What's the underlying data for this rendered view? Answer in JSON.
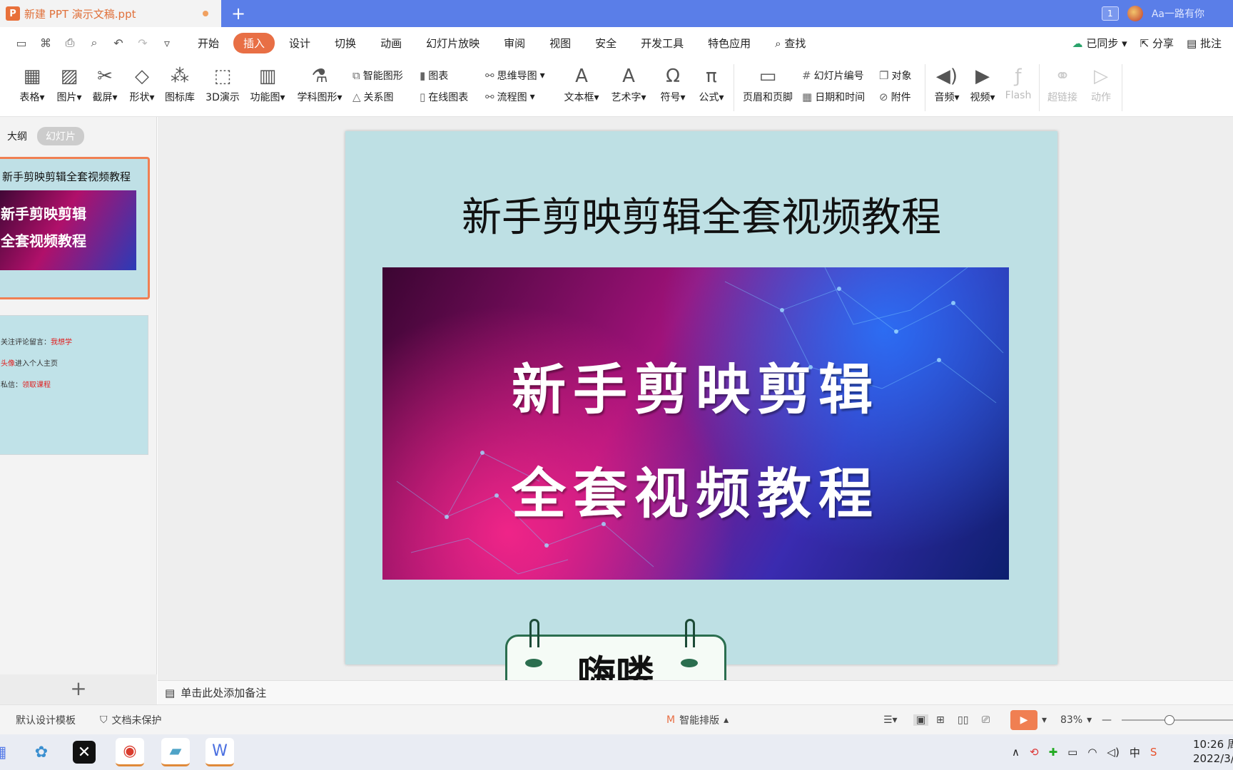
{
  "window": {
    "doc_name": "新建 PPT 演示文稿.ppt",
    "user": "Aa一路有你",
    "counter": "1"
  },
  "quick_access": {
    "save": "💾",
    "undo": "↶",
    "redo": "↷"
  },
  "menu": {
    "items": [
      "开始",
      "插入",
      "设计",
      "切换",
      "动画",
      "幻灯片放映",
      "审阅",
      "视图",
      "安全",
      "开发工具",
      "特色应用"
    ],
    "active": "插入",
    "search": "查找",
    "sync": "已同步",
    "share": "分享",
    "comment": "批注"
  },
  "ribbon": {
    "big_buttons": [
      "表格",
      "图片",
      "截屏",
      "形状",
      "图标库",
      "3D演示",
      "功能图",
      "学科图形"
    ],
    "small_group1": [
      "智能图形",
      "关系图"
    ],
    "small_group2": [
      "图表",
      "在线图表"
    ],
    "small_group3": [
      "思维导图",
      "流程图"
    ],
    "big_buttons2": [
      "文本框",
      "艺术字",
      "符号",
      "公式",
      "页眉和页脚"
    ],
    "small_group4": [
      "幻灯片编号",
      "日期和时间"
    ],
    "small_group5": [
      "对象",
      "附件"
    ],
    "media": [
      "音频",
      "视频",
      "Flash"
    ],
    "disabled": [
      "超链接",
      "动作"
    ]
  },
  "left_panel": {
    "tabs": [
      "大纲",
      "幻灯片"
    ],
    "thumb1_title": "新手剪映剪辑全套视频教程",
    "thumb1_img_lines": [
      "新手剪映剪辑",
      "全套视频教程"
    ],
    "thumb2_lines": [
      {
        "text": "关注评论留言：",
        "red": "我想学"
      },
      {
        "text": "",
        "red": "头像",
        "after": "进入个人主页"
      },
      {
        "text": "私信：",
        "red": "领取课程"
      }
    ]
  },
  "slide": {
    "title": "新手剪映剪辑全套视频教程",
    "image_line1": "新手剪映剪辑",
    "image_line2": "全套视频教程",
    "sticker": "嗨喽"
  },
  "notes": {
    "placeholder": "单击此处添加备注"
  },
  "status": {
    "template": "默认设计模板",
    "protect": "文档未保护",
    "smart_layout": "智能排版",
    "zoom": "83%"
  },
  "taskbar": {
    "time": "10:26 周",
    "date": "2022/3/"
  },
  "colors": {
    "accent": "#e86f45",
    "titlebar": "#5a7ee8",
    "slide_bg": "#bee0e4"
  }
}
